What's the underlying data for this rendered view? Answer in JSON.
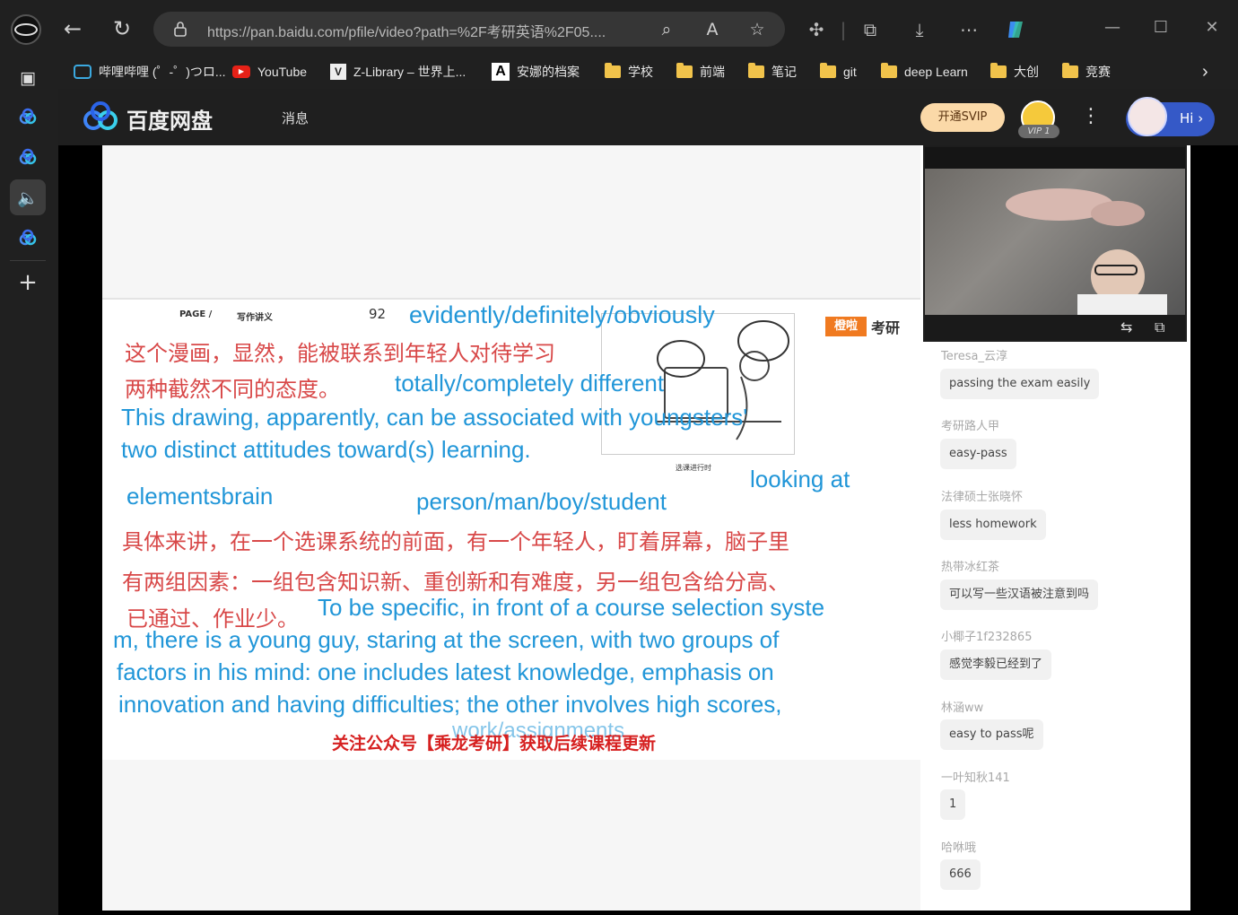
{
  "browser": {
    "url": "https://pan.baidu.com/pfile/video?path=%2F考研英语%2F05....",
    "bookmarks": [
      {
        "label": "哔哩哔哩 (゜-゜)つロ...",
        "icon": "bilibili-icon"
      },
      {
        "label": "YouTube",
        "icon": "youtube-icon"
      },
      {
        "label": "Z-Library – 世界上...",
        "icon": "zlibrary-icon"
      },
      {
        "label": "安娜的档案",
        "icon": "annas-archive-icon"
      },
      {
        "label": "学校",
        "icon": "folder-icon"
      },
      {
        "label": "前端",
        "icon": "folder-icon"
      },
      {
        "label": "笔记",
        "icon": "folder-icon"
      },
      {
        "label": "git",
        "icon": "folder-icon"
      },
      {
        "label": "deep Learn",
        "icon": "folder-icon"
      },
      {
        "label": "大创",
        "icon": "folder-icon"
      },
      {
        "label": "竞赛",
        "icon": "folder-icon"
      }
    ]
  },
  "header": {
    "logo_text": "百度网盘",
    "message_label": "消息",
    "svip_label": "开通SVIP",
    "vip_badge": "VIP 1",
    "hi_label": "Hi ›"
  },
  "slide": {
    "page_label": "PAGE /",
    "section_label": "写作讲义",
    "page_number": "92",
    "brand_badge": "橙啦",
    "brand_text": "考研",
    "promo": "关注公众号【乘龙考研】获取后续课程更新",
    "illus_caption": "选课进行时",
    "lines": [
      {
        "text": "evidently/definitely/obviously",
        "color": "blue"
      },
      {
        "text": "这个漫画，显然，能被联系到年轻人对待学习",
        "color": "red"
      },
      {
        "text": "两种截然不同的态度。",
        "color": "red"
      },
      {
        "text": "totally/completely different",
        "color": "blue"
      },
      {
        "text": "This drawing, apparently, can be associated with youngsters'",
        "color": "blue"
      },
      {
        "text": "two distinct  attitudes toward(s) learning.",
        "color": "blue"
      },
      {
        "text": "elementsbrain",
        "color": "blue"
      },
      {
        "text": "person/man/boy/student",
        "color": "blue"
      },
      {
        "text": "looking at",
        "color": "blue"
      },
      {
        "text": "具体来讲，在一个选课系统的前面，有一个年轻人，盯着屏幕，脑子里",
        "color": "red"
      },
      {
        "text": "有两组因素：一组包含知识新、重创新和有难度，另一组包含给分高、",
        "color": "red"
      },
      {
        "text": "已通过、作业少。",
        "color": "red"
      },
      {
        "text": "To be specific, in front of a course selection syste",
        "color": "blue"
      },
      {
        "text": "m, there is a young guy, staring at the screen, with two groups of",
        "color": "blue"
      },
      {
        "text": "factors in his mind: one includes latest knowledge, emphasis on",
        "color": "blue"
      },
      {
        "text": "innovation and having difficulties; the other involves high scores,",
        "color": "blue"
      },
      {
        "text": "work/assignments",
        "color": "blue"
      }
    ]
  },
  "chat": {
    "messages": [
      {
        "user": "Teresa_云淳",
        "text": "passing the exam easily"
      },
      {
        "user": "考研路人甲",
        "text": "easy-pass"
      },
      {
        "user": "法律硕士张晓怀",
        "text": "less homework"
      },
      {
        "user": "热带冰红茶",
        "text": "可以写一些汉语被注意到吗"
      },
      {
        "user": "小椰子1f232865",
        "text": "感觉李毅已经到了"
      },
      {
        "user": "林涵ww",
        "text": "easy to pass呢"
      },
      {
        "user": "一叶知秋141",
        "text": "1"
      },
      {
        "user": "哈咻哦",
        "text": "666"
      }
    ]
  }
}
